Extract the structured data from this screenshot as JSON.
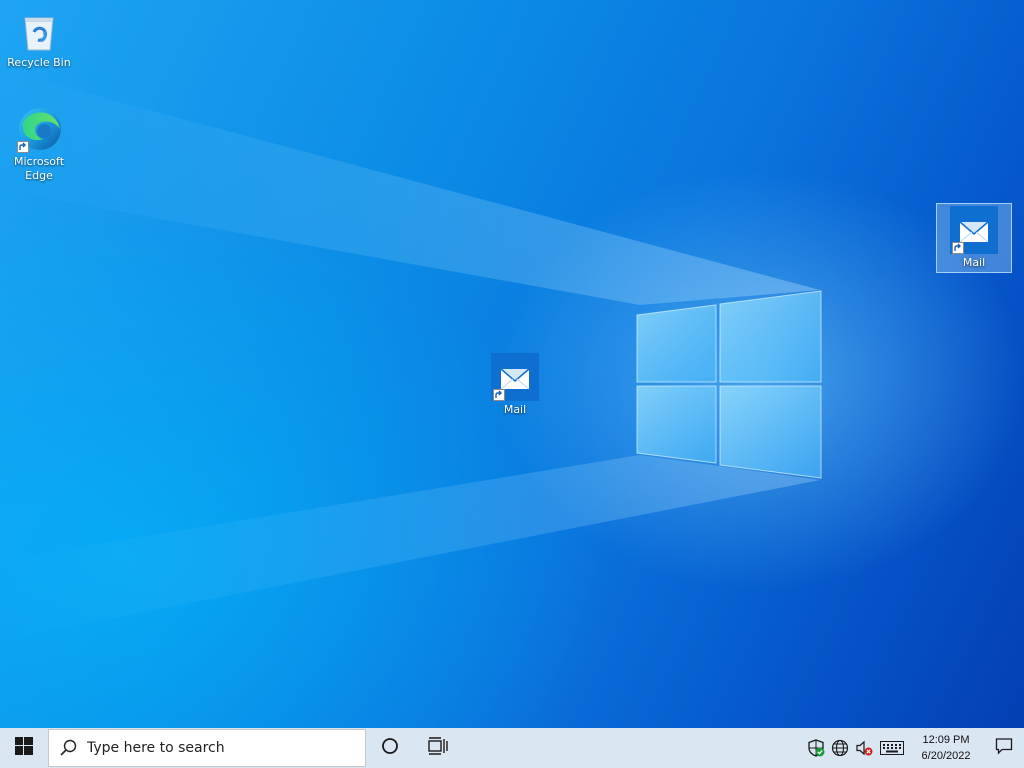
{
  "desktop": {
    "icons": [
      {
        "label": "Recycle Bin",
        "icon": "recycle-bin-icon"
      },
      {
        "label": "Microsoft Edge",
        "icon": "edge-icon",
        "shortcut": true
      },
      {
        "label": "Mail",
        "icon": "mail-icon",
        "shortcut": true
      },
      {
        "label": "Mail",
        "icon": "mail-icon",
        "shortcut": true,
        "selected": true
      }
    ]
  },
  "taskbar": {
    "start_icon": "windows-logo-icon",
    "search": {
      "placeholder": "Type here to search",
      "icon": "search-icon"
    },
    "cortana_icon": "cortana-circle-icon",
    "task_view_icon": "task-view-icon",
    "tray": {
      "icons": [
        "defender-shield-icon",
        "network-globe-icon",
        "volume-muted-icon",
        "keyboard-icon"
      ],
      "time": "12:09 PM",
      "date": "6/20/2022",
      "notifications_icon": "action-center-icon"
    }
  },
  "colors": {
    "accent": "#0a74dd",
    "taskbar": "#dbe6f3"
  }
}
